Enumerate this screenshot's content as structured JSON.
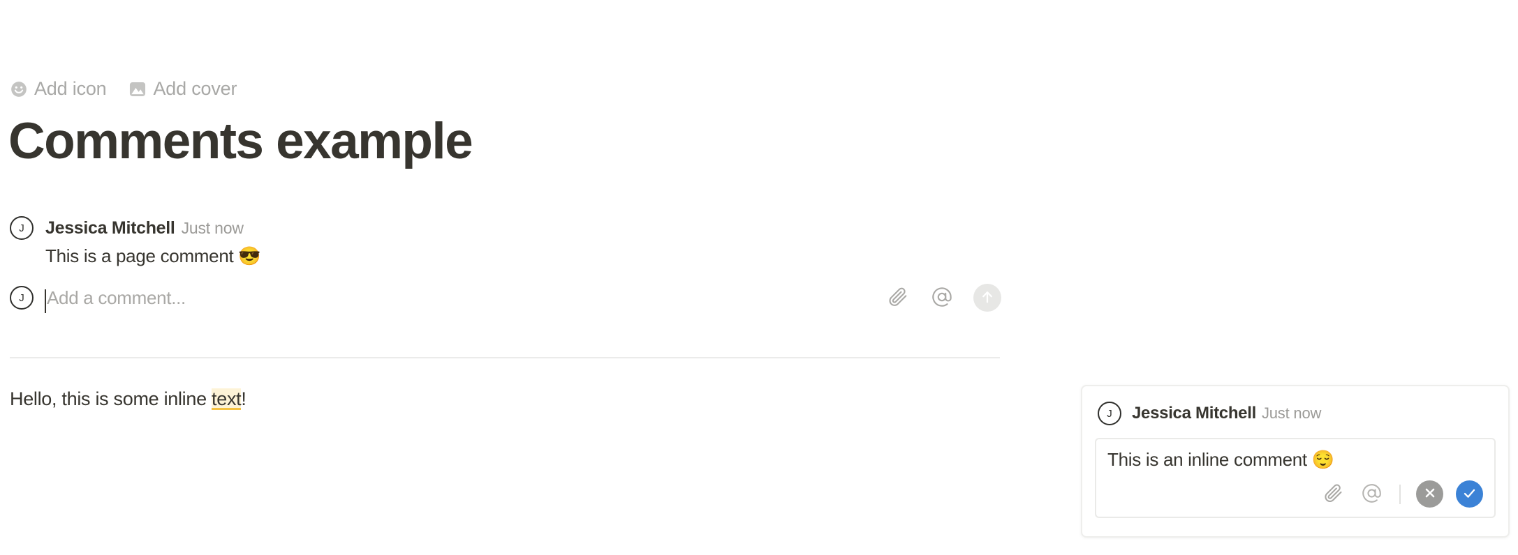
{
  "page_controls": [
    {
      "label": "Add icon",
      "icon": "smiley-face-icon"
    },
    {
      "label": "Add cover",
      "icon": "image-icon"
    }
  ],
  "title": "Comments example",
  "page_comment": {
    "avatar_initial": "J",
    "author": "Jessica Mitchell",
    "timestamp": "Just now",
    "body": "This is a page comment 😎"
  },
  "composer": {
    "avatar_initial": "J",
    "placeholder": "Add a comment...",
    "value": "",
    "actions": [
      {
        "name": "attach",
        "icon": "paperclip-icon"
      },
      {
        "name": "mention",
        "icon": "at-sign-icon"
      },
      {
        "name": "submit",
        "icon": "arrow-up-icon"
      }
    ]
  },
  "inline_paragraph": {
    "before": "Hello, this is some inline ",
    "highlighted": "text",
    "after": "!",
    "highlight_bg": "#fdf3d7",
    "highlight_underline": "#f5c242"
  },
  "inline_panel": {
    "avatar_initial": "J",
    "author": "Jessica Mitchell",
    "timestamp": "Just now",
    "editor_value": "This is an inline comment 😌",
    "actions": [
      {
        "name": "attach",
        "icon": "paperclip-icon"
      },
      {
        "name": "mention",
        "icon": "at-sign-icon"
      },
      {
        "name": "cancel",
        "icon": "close-x-icon",
        "color": "#9b9b99"
      },
      {
        "name": "confirm",
        "icon": "check-icon",
        "color": "#3b82d6"
      }
    ]
  }
}
